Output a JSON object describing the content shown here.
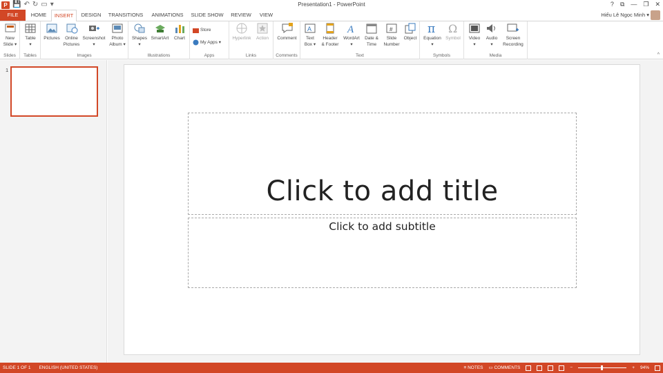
{
  "window": {
    "title": "Presentation1 - PowerPoint",
    "controls": {
      "help": "?",
      "restore_ribbon": "⧉",
      "minimize": "—",
      "maximize": "❐",
      "close": "✕"
    }
  },
  "qat": {
    "save": "💾",
    "undo": "↶",
    "redo": "↻",
    "customize": "▾"
  },
  "tabs": [
    "FILE",
    "HOME",
    "INSERT",
    "DESIGN",
    "TRANSITIONS",
    "ANIMATIONS",
    "SLIDE SHOW",
    "REVIEW",
    "VIEW"
  ],
  "active_tab": "INSERT",
  "user": {
    "name": "Hiếu Lê Ngọc Minh"
  },
  "ribbon": {
    "groups": {
      "slides": "Slides",
      "tables": "Tables",
      "images": "Images",
      "illustrations": "Illustrations",
      "apps": "Apps",
      "links": "Links",
      "comments": "Comments",
      "text": "Text",
      "symbols": "Symbols",
      "media": "Media"
    },
    "buttons": {
      "new_slide": [
        "New",
        "Slide ▾"
      ],
      "table": [
        "Table",
        "▾"
      ],
      "pictures": "Pictures",
      "online_pictures": [
        "Online",
        "Pictures"
      ],
      "screenshot": [
        "Screenshot",
        "▾"
      ],
      "photo_album": [
        "Photo",
        "Album ▾"
      ],
      "shapes": [
        "Shapes",
        "▾"
      ],
      "smartart": "SmartArt",
      "chart": "Chart",
      "store": "Store",
      "my_apps": "My Apps ▾",
      "hyperlink": "Hyperlink",
      "action": "Action",
      "comment": "Comment",
      "text_box": [
        "Text",
        "Box ▾"
      ],
      "header_footer": [
        "Header",
        "& Footer"
      ],
      "wordart": [
        "WordArt",
        "▾"
      ],
      "date_time": [
        "Date &",
        "Time"
      ],
      "slide_number": [
        "Slide",
        "Number"
      ],
      "object": "Object",
      "equation": [
        "Equation",
        "▾"
      ],
      "symbol": "Symbol",
      "video": [
        "Video",
        "▾"
      ],
      "audio": [
        "Audio",
        "▾"
      ],
      "screen_recording": [
        "Screen",
        "Recording"
      ]
    },
    "collapse": "^"
  },
  "slides_panel": {
    "slide_number": "1"
  },
  "slide": {
    "title_placeholder": "Click to add title",
    "subtitle_placeholder": "Click to add subtitle"
  },
  "status": {
    "slide_of": "SLIDE 1 OF 1",
    "language": "ENGLISH (UNITED STATES)",
    "notes": "NOTES",
    "comments": "COMMENTS",
    "zoom": "94%",
    "zoom_out": "−",
    "zoom_in": "+"
  },
  "colors": {
    "accent": "#d24726",
    "panel_bg": "#f3f3f3",
    "ribbon_border": "#d5d5d5"
  }
}
